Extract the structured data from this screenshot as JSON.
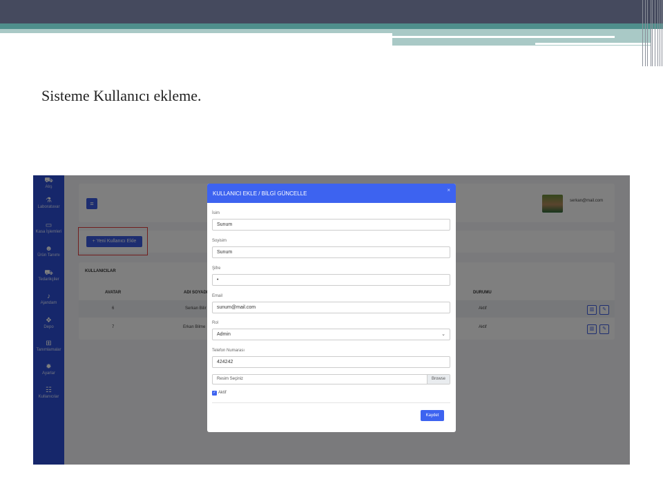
{
  "slide": {
    "title": "Sisteme Kullanıcı ekleme."
  },
  "sidebar": {
    "items": [
      {
        "icon": "truck-icon",
        "label": "Alış"
      },
      {
        "icon": "flask-icon",
        "label": "Laboratuvar"
      },
      {
        "icon": "cash-register-icon",
        "label": "Kasa İşlemleri"
      },
      {
        "icon": "people-icon",
        "label": "Ürün Tanımı"
      },
      {
        "icon": "truck-icon",
        "label": "Tedarikçiler"
      },
      {
        "icon": "bell-icon",
        "label": "Ajandam"
      },
      {
        "icon": "dropbox-icon",
        "label": "Depo"
      },
      {
        "icon": "plus-square-icon",
        "label": "Tanımlamalar"
      },
      {
        "icon": "gear-icon",
        "label": "Ayarlar"
      },
      {
        "icon": "users-icon",
        "label": "Kullanıcılar"
      }
    ]
  },
  "header": {
    "menu_icon": "≡",
    "user_email": "serkan@mail.com"
  },
  "toolbar": {
    "new_user_label": "+ Yeni Kullanıcı Ekle"
  },
  "users_table": {
    "title": "KULLANICILAR",
    "columns": [
      "AVATAR",
      "ADI SOYADI",
      "DURUMU"
    ],
    "rows": [
      {
        "avatar": "6",
        "name": "Serkan Bilir",
        "status": "Aktif"
      },
      {
        "avatar": "7",
        "name": "Erkan Bilme",
        "status": "Aktif"
      }
    ]
  },
  "modal": {
    "title": "KULLANICI EKLE / BİLGİ GÜNCELLE",
    "close": "×",
    "fields": {
      "name": {
        "label": "İsim",
        "value": "Sunum"
      },
      "surname": {
        "label": "Soyisim",
        "value": "Sunum"
      },
      "password": {
        "label": "Şifre",
        "value": "•"
      },
      "email": {
        "label": "Email",
        "value": "sunum@mail.com"
      },
      "role": {
        "label": "Rol",
        "value": "Admin"
      },
      "phone": {
        "label": "Telefon Numarası",
        "value": "424242"
      }
    },
    "file": {
      "placeholder": "Resim Seçiniz",
      "browse": "Browse"
    },
    "active": {
      "label": "Aktif",
      "checked": true
    },
    "save_label": "Kaydet"
  },
  "colors": {
    "primary": "#3d63f0",
    "sidebar": "#2d4fd6",
    "highlight": "#e23a3a"
  }
}
